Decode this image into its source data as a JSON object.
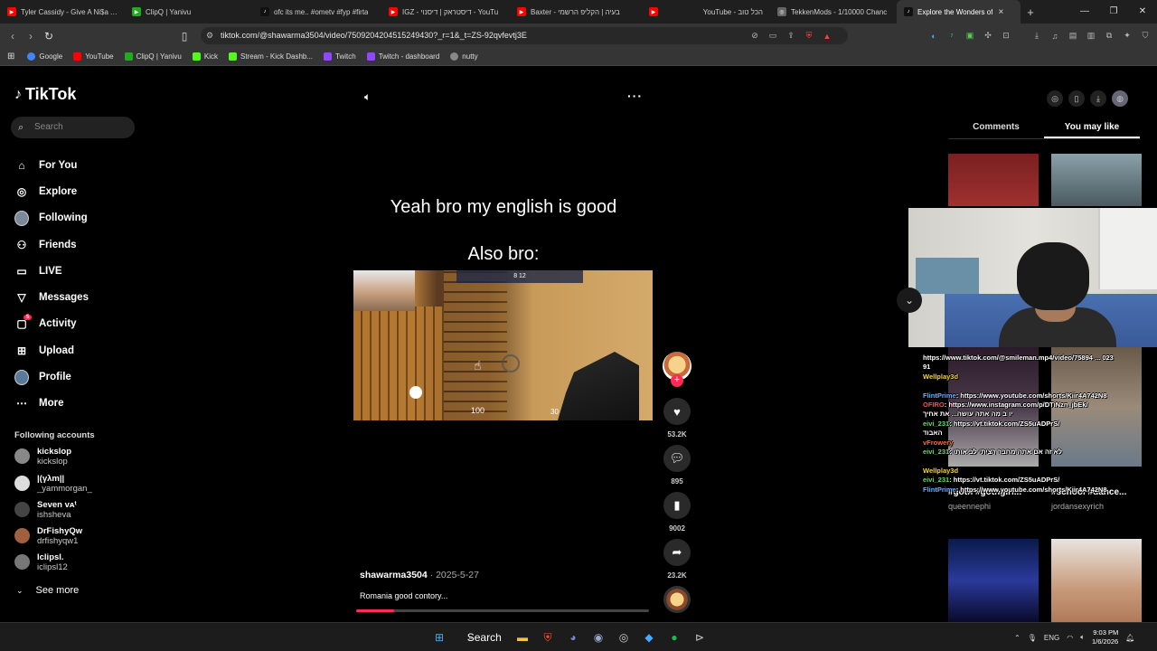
{
  "browser": {
    "tabs": [
      {
        "title": "Tyler Cassidy - Give A Ni$a A B",
        "icon_color": "#ff0000"
      },
      {
        "title": "ClipQ | Yanivu",
        "icon_color": "#22aa22"
      },
      {
        "title": "ofc its me.. #ometv #fyp #firta",
        "icon_color": "#111111"
      },
      {
        "title": "IGZ - דיסטראק | דיסנוי - YouTu",
        "icon_color": "#ff0000"
      },
      {
        "title": "Baxter - בעיה | הקליפ הרשמי",
        "icon_color": "#ff0000"
      },
      {
        "title": "YouTube - הכל טוב",
        "icon_color": "#ff0000"
      },
      {
        "title": "TekkenMods - 1/10000 Chanc",
        "icon_color": "#666666"
      },
      {
        "title": "Explore the Wonders of",
        "icon_color": "#111111"
      }
    ],
    "url": "tiktok.com/@shawarma3504/video/7509204204515249430?_r=1&_t=ZS-92qvfevtj3E",
    "bookmarks": [
      {
        "label": "Google",
        "color": "#4285f4"
      },
      {
        "label": "YouTube",
        "color": "#ff0000"
      },
      {
        "label": "ClipQ | Yanivu",
        "color": "#22aa22"
      },
      {
        "label": "Kick",
        "color": "#53fc18"
      },
      {
        "label": "Stream - Kick Dashb...",
        "color": "#53fc18"
      },
      {
        "label": "Twitch",
        "color": "#9146ff"
      },
      {
        "label": "Twitch - dashboard",
        "color": "#9146ff"
      },
      {
        "label": "nutty",
        "color": "#888888"
      }
    ]
  },
  "sidebar": {
    "brand": "TikTok",
    "search_placeholder": "Search",
    "nav": [
      {
        "label": "For You",
        "icon": "home-icon"
      },
      {
        "label": "Explore",
        "icon": "compass-icon"
      },
      {
        "label": "Following",
        "icon": "avatar-icon"
      },
      {
        "label": "Friends",
        "icon": "friends-icon"
      },
      {
        "label": "LIVE",
        "icon": "live-icon"
      },
      {
        "label": "Messages",
        "icon": "messages-icon"
      },
      {
        "label": "Activity",
        "icon": "activity-icon",
        "badge": "5"
      },
      {
        "label": "Upload",
        "icon": "upload-icon"
      },
      {
        "label": "Profile",
        "icon": "profile-icon"
      },
      {
        "label": "More",
        "icon": "more-icon"
      }
    ],
    "following_title": "Following accounts",
    "accounts": [
      {
        "name": "kickslop",
        "handle": "kickslop"
      },
      {
        "name": "|(γλm||",
        "handle": "_yammorgan_"
      },
      {
        "name": "Seven ᴠᴀᵗ",
        "handle": "ishsheva"
      },
      {
        "name": "DrFishyQw",
        "handle": "drfishyqw1"
      },
      {
        "name": "Iclipsl.",
        "handle": "iclipsl12"
      }
    ],
    "see_more": "See more"
  },
  "video": {
    "caption_line1": "Yeah bro my english is good",
    "caption_line2": "Also bro:",
    "hud_numbers": "8 12",
    "hp": "100",
    "ammo": "30",
    "author": "shawarma3504",
    "date": "2025-5-27",
    "description": "Romania good contory...",
    "progress": 0.13
  },
  "actions": {
    "likes": "53.2K",
    "comments": "895",
    "saves": "9002",
    "shares": "23.2K"
  },
  "right_panel": {
    "tabs": [
      "Comments",
      "You may like"
    ],
    "active_tab": "You may like",
    "thumbs": [
      {
        "caption": "#goth #gothgirl...",
        "author": "queennephi"
      },
      {
        "caption": "#school #dance...",
        "author": "jordansexyrich"
      }
    ]
  },
  "chat": [
    {
      "user": "",
      "msg": "https://www.tiktok.com/@smileman.mp4/video/75894 ... 023"
    },
    {
      "user": "",
      "msg": "91"
    },
    {
      "user": "Wellplay3d",
      "msg": ""
    },
    {
      "user": "",
      "msg": ""
    },
    {
      "user": "FlintPrime",
      "msg": ": https://www.youtube.com/shorts/Kiir4A742N8"
    },
    {
      "user": "OFIRO",
      "msg": ": https://www.instagram.com/p/DTiNzn_jbEk/"
    },
    {
      "user": "",
      "msg": "יו ב מה אתה עושה... את אחיך"
    },
    {
      "user": "eivi_231",
      "msg": ": https://vt.tiktok.com/ZS5uADPrS/"
    },
    {
      "user": "",
      "msg": "האבוד"
    },
    {
      "user": "vFrowery",
      "msg": ""
    },
    {
      "user": "eivi_231",
      "msg": ": לא זה אם אתה מחבר רציתי לב אותו"
    },
    {
      "user": "",
      "msg": ""
    },
    {
      "user": "Wellplay3d",
      "msg": ""
    },
    {
      "user": "eivi_231",
      "msg": ": https://vt.tiktok.com/ZS5uADPrS/"
    },
    {
      "user": "FlintPrime",
      "msg": ": https://www.youtube.com/shorts/Kiir4A742N8"
    }
  ],
  "taskbar": {
    "search_label": "Search",
    "lang": "ENG",
    "time": "9:03 PM",
    "date": "1/6/2026"
  }
}
